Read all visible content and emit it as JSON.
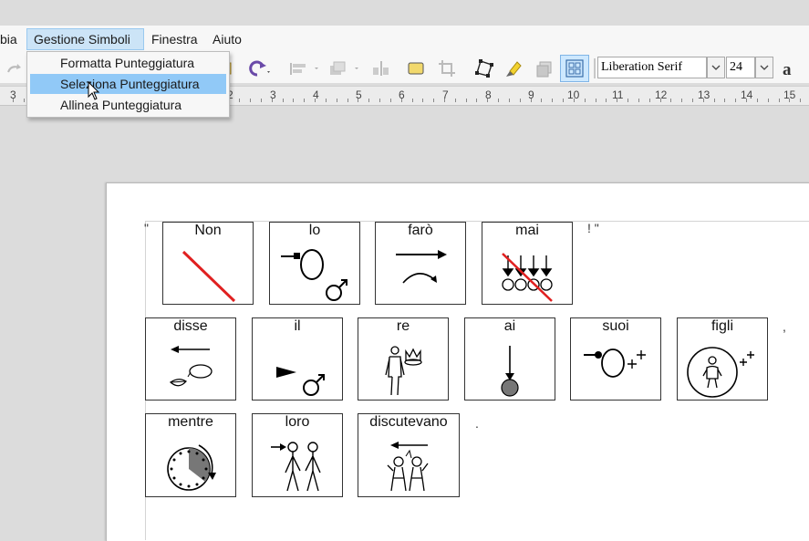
{
  "menubar": {
    "items": [
      "bia",
      "Gestione Simboli",
      "Finestra",
      "Aiuto"
    ]
  },
  "dropdown": {
    "items": [
      {
        "label": "Formatta Punteggiatura"
      },
      {
        "label": "Seleziona Punteggiatura"
      },
      {
        "label": "Allinea Punteggiatura"
      }
    ],
    "selected_index": 1
  },
  "toolbar": {
    "font_name": "Liberation Serif",
    "font_size": "24"
  },
  "ruler": {
    "labels": [
      "3",
      "2",
      "3",
      "4",
      "5",
      "6",
      "7",
      "8",
      "9",
      "10",
      "11",
      "12",
      "13",
      "14",
      "15"
    ]
  },
  "document": {
    "row1": {
      "open_quote": "\"",
      "cards": [
        {
          "word": "Non",
          "icon": "negation-slash-icon"
        },
        {
          "word": "lo",
          "icon": "object-male-pronoun-icon"
        },
        {
          "word": "farò",
          "icon": "future-action-arrow-icon"
        },
        {
          "word": "mai",
          "icon": "never-clocks-crossed-icon"
        }
      ],
      "trailing": "!  \""
    },
    "row2": {
      "cards": [
        {
          "word": "disse",
          "icon": "speak-past-icon"
        },
        {
          "word": "il",
          "icon": "article-male-icon"
        },
        {
          "word": "re",
          "icon": "king-crown-icon"
        },
        {
          "word": "ai",
          "icon": "to-the-point-icon"
        },
        {
          "word": "suoi",
          "icon": "his-plural-icon"
        },
        {
          "word": "figli",
          "icon": "children-plural-icon"
        }
      ],
      "trailing": ","
    },
    "row3": {
      "cards": [
        {
          "word": "mentre",
          "icon": "while-clock-icon"
        },
        {
          "word": "loro",
          "icon": "them-people-icon"
        },
        {
          "word": "discutevano",
          "icon": "argue-past-icon"
        }
      ],
      "trailing": "."
    }
  },
  "colors": {
    "menu_highlight": "#91c9f7",
    "menu_open": "#cce4f7",
    "negation_red": "#e02020",
    "toolbar_active": "#cde8ff"
  }
}
